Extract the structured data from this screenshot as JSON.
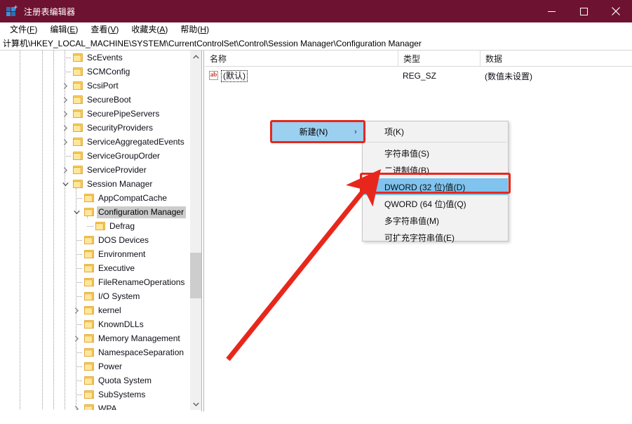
{
  "window": {
    "title": "注册表编辑器",
    "icon": "registry-editor-icon",
    "accent_color": "#6d1230",
    "minimize_label": "最小化",
    "maximize_label": "最大化",
    "close_label": "关闭"
  },
  "menubar": {
    "items": [
      {
        "label": "文件(F)",
        "text": "文件(",
        "accel": "F",
        "tail": ")"
      },
      {
        "label": "编辑(E)",
        "text": "编辑(",
        "accel": "E",
        "tail": ")"
      },
      {
        "label": "查看(V)",
        "text": "查看(",
        "accel": "V",
        "tail": ")"
      },
      {
        "label": "收藏夹(A)",
        "text": "收藏夹(",
        "accel": "A",
        "tail": ")"
      },
      {
        "label": "帮助(H)",
        "text": "帮助(",
        "accel": "H",
        "tail": ")"
      }
    ]
  },
  "addressbar": {
    "path": "计算机\\HKEY_LOCAL_MACHINE\\SYSTEM\\CurrentControlSet\\Control\\Session Manager\\Configuration Manager"
  },
  "tree": {
    "items": [
      {
        "label": "ScEvents",
        "level": 0,
        "expander": "none",
        "selected": false
      },
      {
        "label": "SCMConfig",
        "level": 0,
        "expander": "none",
        "selected": false
      },
      {
        "label": "ScsiPort",
        "level": 0,
        "expander": "collapsed",
        "selected": false
      },
      {
        "label": "SecureBoot",
        "level": 0,
        "expander": "collapsed",
        "selected": false
      },
      {
        "label": "SecurePipeServers",
        "level": 0,
        "expander": "collapsed",
        "selected": false
      },
      {
        "label": "SecurityProviders",
        "level": 0,
        "expander": "collapsed",
        "selected": false
      },
      {
        "label": "ServiceAggregatedEvents",
        "level": 0,
        "expander": "collapsed",
        "selected": false
      },
      {
        "label": "ServiceGroupOrder",
        "level": 0,
        "expander": "none",
        "selected": false
      },
      {
        "label": "ServiceProvider",
        "level": 0,
        "expander": "collapsed",
        "selected": false
      },
      {
        "label": "Session Manager",
        "level": 0,
        "expander": "expanded",
        "selected": false
      },
      {
        "label": "AppCompatCache",
        "level": 1,
        "expander": "none",
        "selected": false
      },
      {
        "label": "Configuration Manager",
        "level": 1,
        "expander": "expanded",
        "selected": true
      },
      {
        "label": "Defrag",
        "level": 2,
        "expander": "none",
        "selected": false
      },
      {
        "label": "DOS Devices",
        "level": 1,
        "expander": "none",
        "selected": false
      },
      {
        "label": "Environment",
        "level": 1,
        "expander": "none",
        "selected": false
      },
      {
        "label": "Executive",
        "level": 1,
        "expander": "none",
        "selected": false
      },
      {
        "label": "FileRenameOperations",
        "level": 1,
        "expander": "none",
        "selected": false
      },
      {
        "label": "I/O System",
        "level": 1,
        "expander": "none",
        "selected": false
      },
      {
        "label": "kernel",
        "level": 1,
        "expander": "collapsed",
        "selected": false
      },
      {
        "label": "KnownDLLs",
        "level": 1,
        "expander": "none",
        "selected": false
      },
      {
        "label": "Memory Management",
        "level": 1,
        "expander": "collapsed",
        "selected": false
      },
      {
        "label": "NamespaceSeparation",
        "level": 1,
        "expander": "none",
        "selected": false
      },
      {
        "label": "Power",
        "level": 1,
        "expander": "none",
        "selected": false
      },
      {
        "label": "Quota System",
        "level": 1,
        "expander": "none",
        "selected": false
      },
      {
        "label": "SubSystems",
        "level": 1,
        "expander": "none",
        "selected": false
      },
      {
        "label": "WPA",
        "level": 1,
        "expander": "collapsed",
        "selected": false
      }
    ]
  },
  "listview": {
    "columns": [
      {
        "label": "名称"
      },
      {
        "label": "类型"
      },
      {
        "label": "数据"
      }
    ],
    "rows": [
      {
        "icon": "ab-string-icon",
        "name": "(默认)",
        "type": "REG_SZ",
        "data": "(数值未设置)"
      }
    ]
  },
  "context_menu": {
    "parent": {
      "label": "新建(N)",
      "submenu_arrow": "›",
      "highlighted": true,
      "highlight_border_color": "#e8271c"
    },
    "items": [
      {
        "label": "项(K)",
        "highlighted": false
      },
      {
        "separator": true
      },
      {
        "label": "字符串值(S)",
        "highlighted": false
      },
      {
        "label": "二进制值(B)",
        "highlighted": false
      },
      {
        "label": "DWORD (32 位)值(D)",
        "highlighted": true
      },
      {
        "label": "QWORD (64 位)值(Q)",
        "highlighted": false
      },
      {
        "label": "多字符串值(M)",
        "highlighted": false
      },
      {
        "label": "可扩充字符串值(E)",
        "highlighted": false
      }
    ]
  },
  "annotations": {
    "arrow_color": "#e8271c",
    "highlight_box_color": "#e8271c"
  },
  "scrollbars": {
    "tree_vertical": {
      "up_arrow": "⌃",
      "down_arrow": "⌄"
    },
    "tree_horizontal": {
      "left_arrow": "‹",
      "right_arrow": "›"
    },
    "list_horizontal": {
      "left_arrow": "‹",
      "right_arrow": "›"
    }
  }
}
